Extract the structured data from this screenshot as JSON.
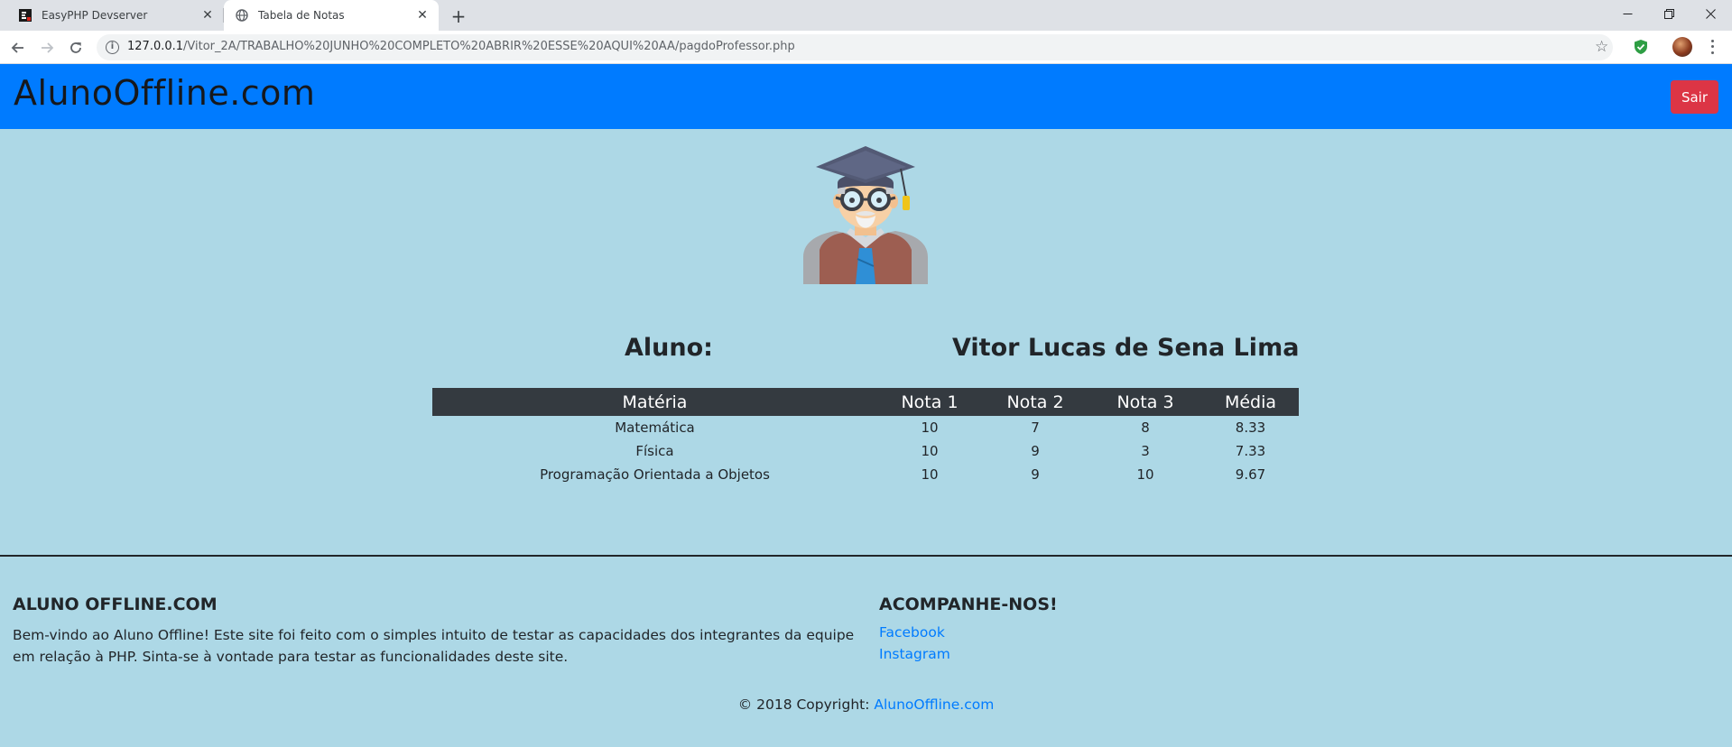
{
  "browser": {
    "tabs": [
      {
        "title": "EasyPHP Devserver",
        "icon": "easyphp-icon",
        "active": false
      },
      {
        "title": "Tabela de Notas",
        "icon": "globe-icon",
        "active": true
      }
    ],
    "url_host": "127.0.0.1",
    "url_path": "/Vitor_2A/TRABALHO%20JUNHO%20COMPLETO%20ABRIR%20ESSE%20AQUI%20AA/pagdoProfessor.php",
    "tab_close_glyph": "✕",
    "new_tab_glyph": "+",
    "star_glyph": "☆",
    "info_glyph": "i"
  },
  "navbar": {
    "brand": "AlunoOffline.com",
    "logout_label": "Sair",
    "color": "#007bff",
    "logout_color": "#dc3545"
  },
  "student": {
    "label": "Aluno:",
    "name": "Vitor Lucas de Sena Lima"
  },
  "grades": {
    "headers": [
      "Matéria",
      "Nota 1",
      "Nota 2",
      "Nota 3",
      "Média"
    ],
    "rows": [
      [
        "Matemática",
        "10",
        "7",
        "8",
        "8.33"
      ],
      [
        "Física",
        "10",
        "9",
        "3",
        "7.33"
      ],
      [
        "Programação Orientada a Objetos",
        "10",
        "9",
        "10",
        "9.67"
      ]
    ]
  },
  "footer": {
    "about_title": "ALUNO OFFLINE.COM",
    "about_text": "Bem-vindo ao Aluno Offline! Este site foi feito com o simples intuito de testar as capacidades dos integrantes da equipe em relação à PHP. Sinta-se à vontade para testar as funcionalidades deste site.",
    "follow_title": "ACOMPANHE-NOS!",
    "links": [
      "Facebook",
      "Instagram"
    ],
    "copyright_prefix": "© 2018 Copyright: ",
    "copyright_link": "AlunoOffline.com"
  },
  "colors": {
    "page_background": "#add8e6",
    "table_header": "#343a40",
    "link": "#007bff"
  }
}
